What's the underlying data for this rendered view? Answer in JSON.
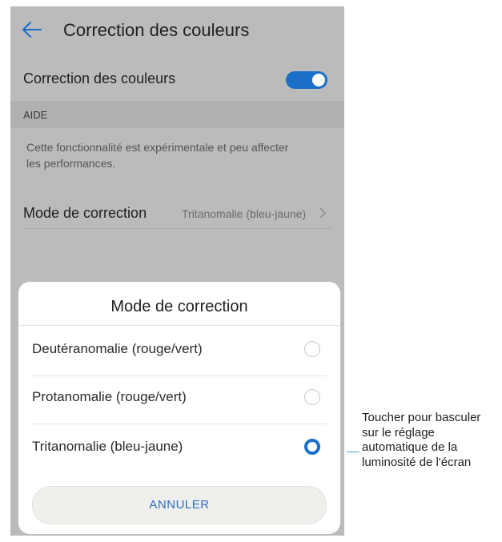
{
  "appbar": {
    "title": "Correction des couleurs",
    "back_icon": "arrow-left-icon"
  },
  "settings": {
    "toggle_row": {
      "label": "Correction des couleurs",
      "enabled": true
    },
    "section_header": "AIDE",
    "help_text": "Cette fonctionnalité est expérimentale et peu affecter les performances.",
    "mode_row": {
      "label": "Mode de correction",
      "value": "Tritanomalie (bleu-jaune)"
    }
  },
  "dialog": {
    "title": "Mode de correction",
    "options": [
      {
        "label": "Deutéranomalie (rouge/vert)",
        "selected": false
      },
      {
        "label": "Protanomalie (rouge/vert)",
        "selected": false
      },
      {
        "label": "Tritanomalie (bleu-jaune)",
        "selected": true
      }
    ],
    "cancel_label": "ANNULER"
  },
  "callout": {
    "text": "Toucher pour basculer sur le réglage automatique de la luminosité de l'écran"
  },
  "colors": {
    "accent": "#1a6fc9",
    "dimmed_background": "#bbbbbb",
    "callout_line": "#3aa6c6"
  }
}
